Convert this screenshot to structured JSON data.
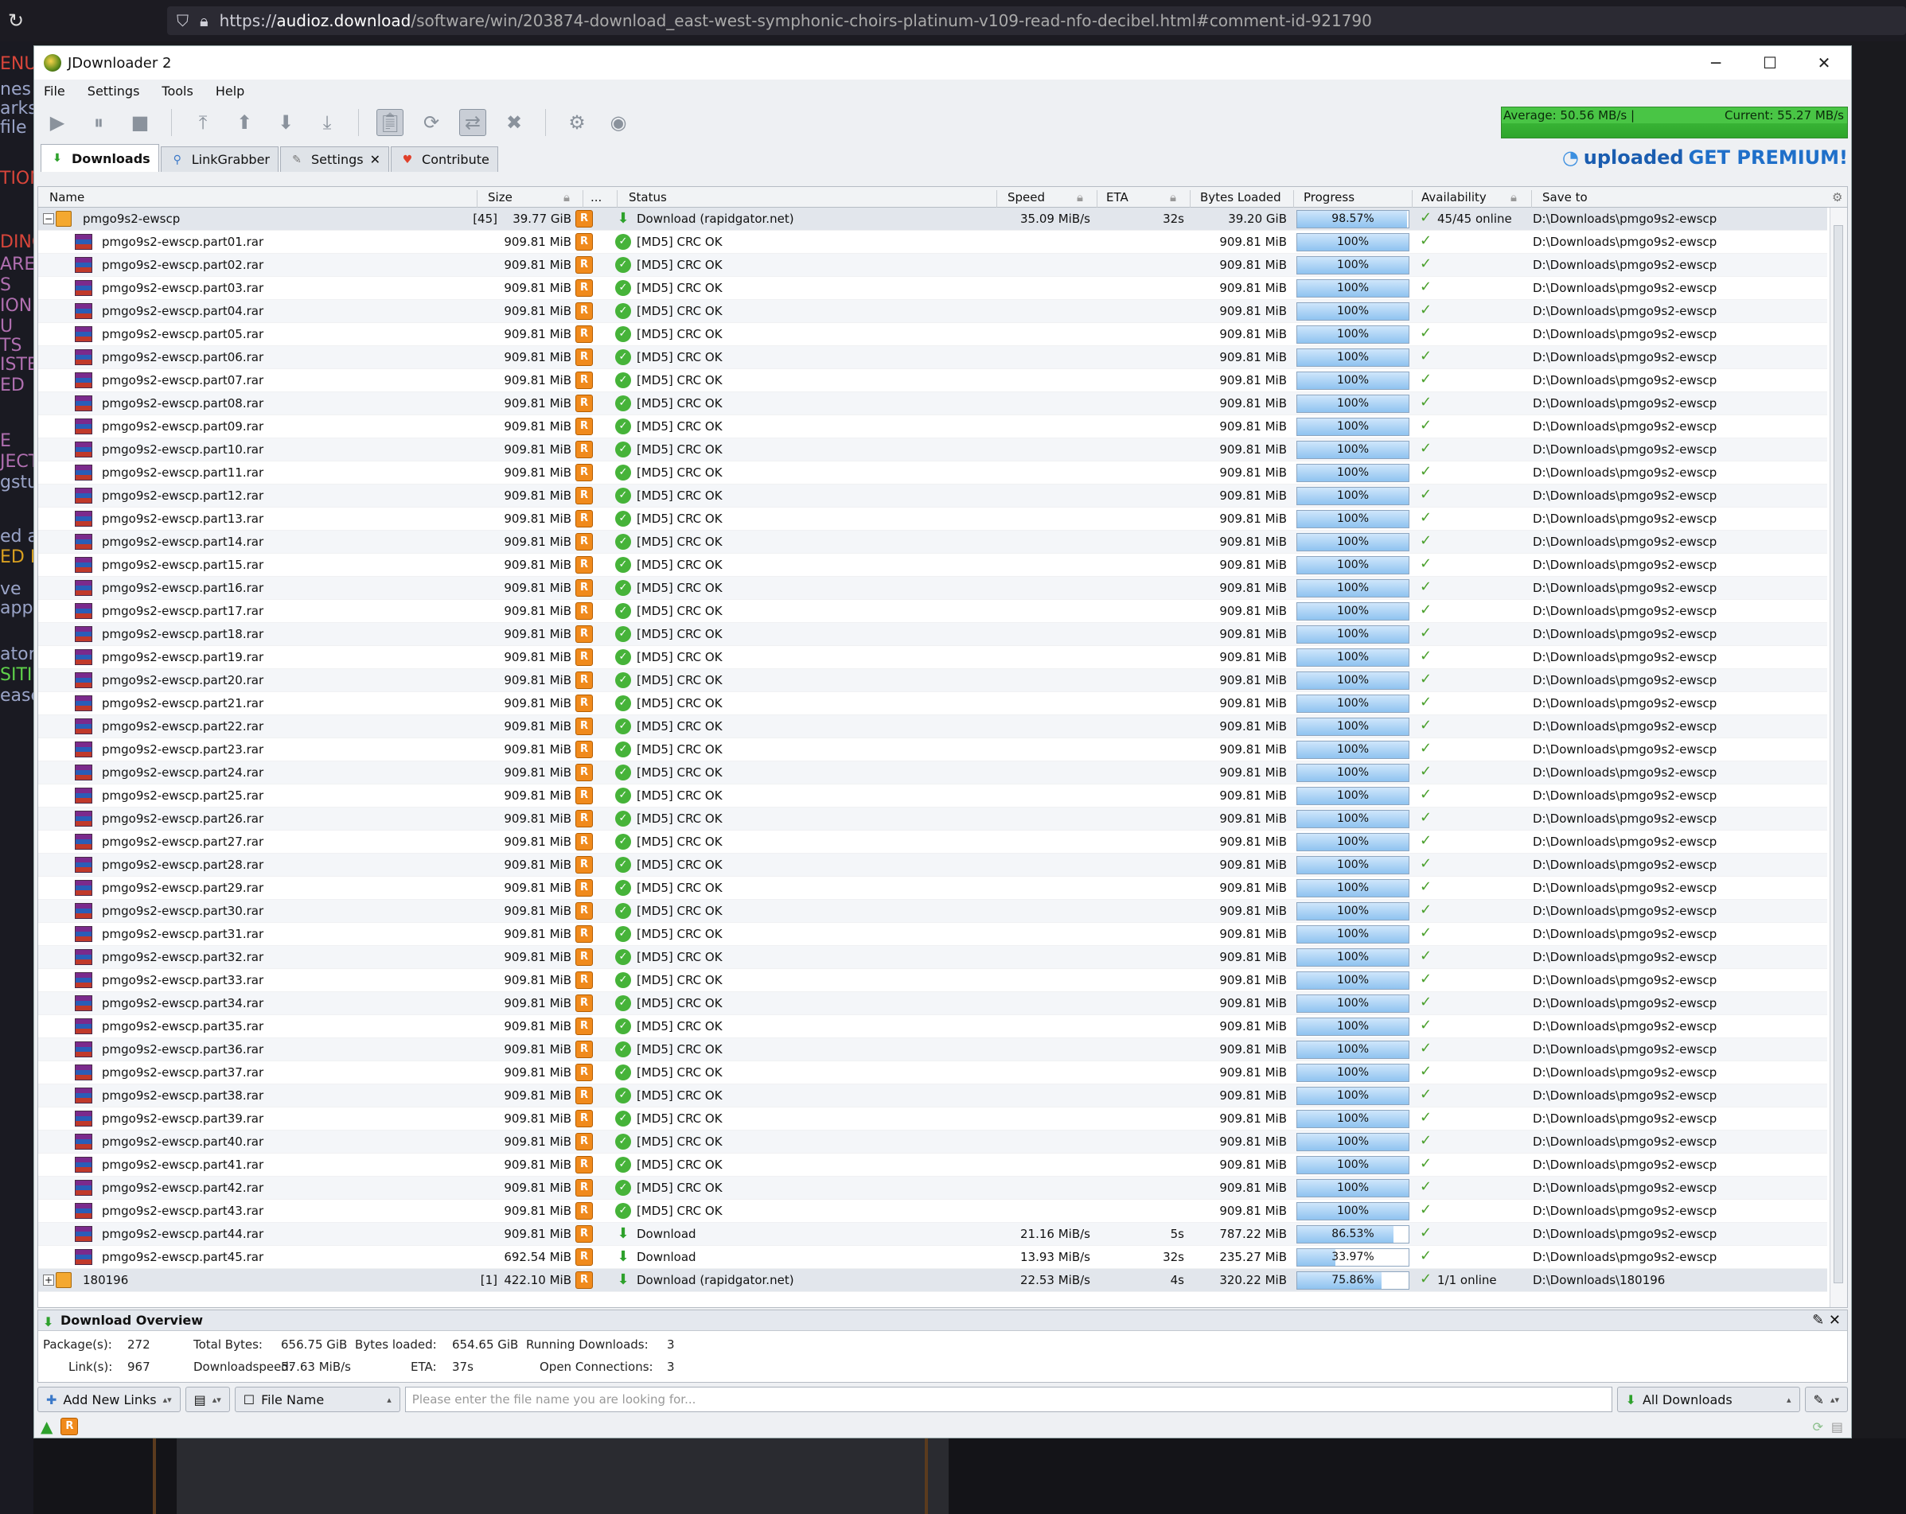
{
  "browser": {
    "url_domain": "audioz.download",
    "url_prefix": "https://",
    "url_rest": "/software/win/203874-download_east-west-symphonic-choirs-platinum-v109-read-nfo-decibel.html#comment-id-921790"
  },
  "background": {
    "left_snippets": [
      {
        "text": "ENU",
        "color": "#d8453a"
      },
      {
        "text": "nes (",
        "color": "#9aa4c8"
      },
      {
        "text": "arks",
        "color": "#9aa4c8"
      },
      {
        "text": "file",
        "color": "#9aa4c8"
      },
      {
        "text": "TION",
        "color": "#d8453a"
      },
      {
        "text": "DING",
        "color": "#d8453a"
      },
      {
        "text": "ARE",
        "color": "#b06fb0"
      },
      {
        "text": "S",
        "color": "#b06fb0"
      },
      {
        "text": "ION",
        "color": "#b06fb0"
      },
      {
        "text": "U",
        "color": "#b06fb0"
      },
      {
        "text": "TS",
        "color": "#b06fb0"
      },
      {
        "text": "ISTE",
        "color": "#b06fb0"
      },
      {
        "text": "ED",
        "color": "#b06fb0"
      },
      {
        "text": "E",
        "color": "#b06fb0"
      },
      {
        "text": "JECT",
        "color": "#b06fb0"
      },
      {
        "text": "gstu",
        "color": "#9aa4c8"
      },
      {
        "text": "ed a",
        "color": "#9aa4c8"
      },
      {
        "text": "ED F",
        "color": "#d9a020"
      },
      {
        "text": "appy",
        "color": "#9aa4c8"
      },
      {
        "text": "ator",
        "color": "#9aa4c8"
      },
      {
        "text": "SITI",
        "color": "#5fd14a"
      },
      {
        "text": "ease",
        "color": "#9aa4c8"
      },
      {
        "text": "ve",
        "color": "#9aa4c8"
      }
    ]
  },
  "window": {
    "title": "JDownloader 2",
    "controls": [
      "─",
      "☐",
      "✕"
    ]
  },
  "menu": [
    "File",
    "Settings",
    "Tools",
    "Help"
  ],
  "speedmeter": {
    "average": "Average: 50.56 MB/s |",
    "current": "Current: 55.27 MB/s"
  },
  "tabs": [
    {
      "label": "Downloads",
      "icon": "download-arrow-icon",
      "active": true
    },
    {
      "label": "LinkGrabber",
      "icon": "linkgrabber-icon",
      "active": false
    },
    {
      "label": "Settings",
      "icon": "wrench-icon",
      "active": false,
      "closable": true
    },
    {
      "label": "Contribute",
      "icon": "heart-icon",
      "active": false
    }
  ],
  "premium": {
    "brand": "uploaded",
    "cta": "GET PREMIUM!"
  },
  "columns": [
    "Name",
    "Size",
    "...",
    "Status",
    "Speed",
    "ETA",
    "Bytes Loaded",
    "Progress",
    "Availability",
    "Save to"
  ],
  "package1": {
    "expander": "−",
    "name": "pmgo9s2-ewscp",
    "count": "[45]",
    "size": "39.77 GiB",
    "status": "Download (rapidgator.net)",
    "speed": "35.09 MiB/s",
    "eta": "32s",
    "loaded": "39.20 GiB",
    "progress": "98.57%",
    "progress_value": 0.9857,
    "availability": "45/45 online",
    "saveto": "D:\\Downloads\\pmgo9s2-ewscp"
  },
  "files": [
    {
      "name": "pmgo9s2-ewscp.part01.rar",
      "size": "909.81 MiB",
      "status": "[MD5] CRC OK",
      "speed": "",
      "eta": "",
      "loaded": "909.81 MiB",
      "progress": "100%",
      "pv": 1,
      "ok": true
    },
    {
      "name": "pmgo9s2-ewscp.part02.rar",
      "size": "909.81 MiB",
      "status": "[MD5] CRC OK",
      "speed": "",
      "eta": "",
      "loaded": "909.81 MiB",
      "progress": "100%",
      "pv": 1,
      "ok": true
    },
    {
      "name": "pmgo9s2-ewscp.part03.rar",
      "size": "909.81 MiB",
      "status": "[MD5] CRC OK",
      "speed": "",
      "eta": "",
      "loaded": "909.81 MiB",
      "progress": "100%",
      "pv": 1,
      "ok": true
    },
    {
      "name": "pmgo9s2-ewscp.part04.rar",
      "size": "909.81 MiB",
      "status": "[MD5] CRC OK",
      "speed": "",
      "eta": "",
      "loaded": "909.81 MiB",
      "progress": "100%",
      "pv": 1,
      "ok": true
    },
    {
      "name": "pmgo9s2-ewscp.part05.rar",
      "size": "909.81 MiB",
      "status": "[MD5] CRC OK",
      "speed": "",
      "eta": "",
      "loaded": "909.81 MiB",
      "progress": "100%",
      "pv": 1,
      "ok": true
    },
    {
      "name": "pmgo9s2-ewscp.part06.rar",
      "size": "909.81 MiB",
      "status": "[MD5] CRC OK",
      "speed": "",
      "eta": "",
      "loaded": "909.81 MiB",
      "progress": "100%",
      "pv": 1,
      "ok": true
    },
    {
      "name": "pmgo9s2-ewscp.part07.rar",
      "size": "909.81 MiB",
      "status": "[MD5] CRC OK",
      "speed": "",
      "eta": "",
      "loaded": "909.81 MiB",
      "progress": "100%",
      "pv": 1,
      "ok": true
    },
    {
      "name": "pmgo9s2-ewscp.part08.rar",
      "size": "909.81 MiB",
      "status": "[MD5] CRC OK",
      "speed": "",
      "eta": "",
      "loaded": "909.81 MiB",
      "progress": "100%",
      "pv": 1,
      "ok": true
    },
    {
      "name": "pmgo9s2-ewscp.part09.rar",
      "size": "909.81 MiB",
      "status": "[MD5] CRC OK",
      "speed": "",
      "eta": "",
      "loaded": "909.81 MiB",
      "progress": "100%",
      "pv": 1,
      "ok": true
    },
    {
      "name": "pmgo9s2-ewscp.part10.rar",
      "size": "909.81 MiB",
      "status": "[MD5] CRC OK",
      "speed": "",
      "eta": "",
      "loaded": "909.81 MiB",
      "progress": "100%",
      "pv": 1,
      "ok": true
    },
    {
      "name": "pmgo9s2-ewscp.part11.rar",
      "size": "909.81 MiB",
      "status": "[MD5] CRC OK",
      "speed": "",
      "eta": "",
      "loaded": "909.81 MiB",
      "progress": "100%",
      "pv": 1,
      "ok": true
    },
    {
      "name": "pmgo9s2-ewscp.part12.rar",
      "size": "909.81 MiB",
      "status": "[MD5] CRC OK",
      "speed": "",
      "eta": "",
      "loaded": "909.81 MiB",
      "progress": "100%",
      "pv": 1,
      "ok": true
    },
    {
      "name": "pmgo9s2-ewscp.part13.rar",
      "size": "909.81 MiB",
      "status": "[MD5] CRC OK",
      "speed": "",
      "eta": "",
      "loaded": "909.81 MiB",
      "progress": "100%",
      "pv": 1,
      "ok": true
    },
    {
      "name": "pmgo9s2-ewscp.part14.rar",
      "size": "909.81 MiB",
      "status": "[MD5] CRC OK",
      "speed": "",
      "eta": "",
      "loaded": "909.81 MiB",
      "progress": "100%",
      "pv": 1,
      "ok": true
    },
    {
      "name": "pmgo9s2-ewscp.part15.rar",
      "size": "909.81 MiB",
      "status": "[MD5] CRC OK",
      "speed": "",
      "eta": "",
      "loaded": "909.81 MiB",
      "progress": "100%",
      "pv": 1,
      "ok": true
    },
    {
      "name": "pmgo9s2-ewscp.part16.rar",
      "size": "909.81 MiB",
      "status": "[MD5] CRC OK",
      "speed": "",
      "eta": "",
      "loaded": "909.81 MiB",
      "progress": "100%",
      "pv": 1,
      "ok": true
    },
    {
      "name": "pmgo9s2-ewscp.part17.rar",
      "size": "909.81 MiB",
      "status": "[MD5] CRC OK",
      "speed": "",
      "eta": "",
      "loaded": "909.81 MiB",
      "progress": "100%",
      "pv": 1,
      "ok": true
    },
    {
      "name": "pmgo9s2-ewscp.part18.rar",
      "size": "909.81 MiB",
      "status": "[MD5] CRC OK",
      "speed": "",
      "eta": "",
      "loaded": "909.81 MiB",
      "progress": "100%",
      "pv": 1,
      "ok": true
    },
    {
      "name": "pmgo9s2-ewscp.part19.rar",
      "size": "909.81 MiB",
      "status": "[MD5] CRC OK",
      "speed": "",
      "eta": "",
      "loaded": "909.81 MiB",
      "progress": "100%",
      "pv": 1,
      "ok": true
    },
    {
      "name": "pmgo9s2-ewscp.part20.rar",
      "size": "909.81 MiB",
      "status": "[MD5] CRC OK",
      "speed": "",
      "eta": "",
      "loaded": "909.81 MiB",
      "progress": "100%",
      "pv": 1,
      "ok": true
    },
    {
      "name": "pmgo9s2-ewscp.part21.rar",
      "size": "909.81 MiB",
      "status": "[MD5] CRC OK",
      "speed": "",
      "eta": "",
      "loaded": "909.81 MiB",
      "progress": "100%",
      "pv": 1,
      "ok": true
    },
    {
      "name": "pmgo9s2-ewscp.part22.rar",
      "size": "909.81 MiB",
      "status": "[MD5] CRC OK",
      "speed": "",
      "eta": "",
      "loaded": "909.81 MiB",
      "progress": "100%",
      "pv": 1,
      "ok": true
    },
    {
      "name": "pmgo9s2-ewscp.part23.rar",
      "size": "909.81 MiB",
      "status": "[MD5] CRC OK",
      "speed": "",
      "eta": "",
      "loaded": "909.81 MiB",
      "progress": "100%",
      "pv": 1,
      "ok": true
    },
    {
      "name": "pmgo9s2-ewscp.part24.rar",
      "size": "909.81 MiB",
      "status": "[MD5] CRC OK",
      "speed": "",
      "eta": "",
      "loaded": "909.81 MiB",
      "progress": "100%",
      "pv": 1,
      "ok": true
    },
    {
      "name": "pmgo9s2-ewscp.part25.rar",
      "size": "909.81 MiB",
      "status": "[MD5] CRC OK",
      "speed": "",
      "eta": "",
      "loaded": "909.81 MiB",
      "progress": "100%",
      "pv": 1,
      "ok": true
    },
    {
      "name": "pmgo9s2-ewscp.part26.rar",
      "size": "909.81 MiB",
      "status": "[MD5] CRC OK",
      "speed": "",
      "eta": "",
      "loaded": "909.81 MiB",
      "progress": "100%",
      "pv": 1,
      "ok": true
    },
    {
      "name": "pmgo9s2-ewscp.part27.rar",
      "size": "909.81 MiB",
      "status": "[MD5] CRC OK",
      "speed": "",
      "eta": "",
      "loaded": "909.81 MiB",
      "progress": "100%",
      "pv": 1,
      "ok": true
    },
    {
      "name": "pmgo9s2-ewscp.part28.rar",
      "size": "909.81 MiB",
      "status": "[MD5] CRC OK",
      "speed": "",
      "eta": "",
      "loaded": "909.81 MiB",
      "progress": "100%",
      "pv": 1,
      "ok": true
    },
    {
      "name": "pmgo9s2-ewscp.part29.rar",
      "size": "909.81 MiB",
      "status": "[MD5] CRC OK",
      "speed": "",
      "eta": "",
      "loaded": "909.81 MiB",
      "progress": "100%",
      "pv": 1,
      "ok": true
    },
    {
      "name": "pmgo9s2-ewscp.part30.rar",
      "size": "909.81 MiB",
      "status": "[MD5] CRC OK",
      "speed": "",
      "eta": "",
      "loaded": "909.81 MiB",
      "progress": "100%",
      "pv": 1,
      "ok": true
    },
    {
      "name": "pmgo9s2-ewscp.part31.rar",
      "size": "909.81 MiB",
      "status": "[MD5] CRC OK",
      "speed": "",
      "eta": "",
      "loaded": "909.81 MiB",
      "progress": "100%",
      "pv": 1,
      "ok": true
    },
    {
      "name": "pmgo9s2-ewscp.part32.rar",
      "size": "909.81 MiB",
      "status": "[MD5] CRC OK",
      "speed": "",
      "eta": "",
      "loaded": "909.81 MiB",
      "progress": "100%",
      "pv": 1,
      "ok": true
    },
    {
      "name": "pmgo9s2-ewscp.part33.rar",
      "size": "909.81 MiB",
      "status": "[MD5] CRC OK",
      "speed": "",
      "eta": "",
      "loaded": "909.81 MiB",
      "progress": "100%",
      "pv": 1,
      "ok": true
    },
    {
      "name": "pmgo9s2-ewscp.part34.rar",
      "size": "909.81 MiB",
      "status": "[MD5] CRC OK",
      "speed": "",
      "eta": "",
      "loaded": "909.81 MiB",
      "progress": "100%",
      "pv": 1,
      "ok": true
    },
    {
      "name": "pmgo9s2-ewscp.part35.rar",
      "size": "909.81 MiB",
      "status": "[MD5] CRC OK",
      "speed": "",
      "eta": "",
      "loaded": "909.81 MiB",
      "progress": "100%",
      "pv": 1,
      "ok": true
    },
    {
      "name": "pmgo9s2-ewscp.part36.rar",
      "size": "909.81 MiB",
      "status": "[MD5] CRC OK",
      "speed": "",
      "eta": "",
      "loaded": "909.81 MiB",
      "progress": "100%",
      "pv": 1,
      "ok": true
    },
    {
      "name": "pmgo9s2-ewscp.part37.rar",
      "size": "909.81 MiB",
      "status": "[MD5] CRC OK",
      "speed": "",
      "eta": "",
      "loaded": "909.81 MiB",
      "progress": "100%",
      "pv": 1,
      "ok": true
    },
    {
      "name": "pmgo9s2-ewscp.part38.rar",
      "size": "909.81 MiB",
      "status": "[MD5] CRC OK",
      "speed": "",
      "eta": "",
      "loaded": "909.81 MiB",
      "progress": "100%",
      "pv": 1,
      "ok": true
    },
    {
      "name": "pmgo9s2-ewscp.part39.rar",
      "size": "909.81 MiB",
      "status": "[MD5] CRC OK",
      "speed": "",
      "eta": "",
      "loaded": "909.81 MiB",
      "progress": "100%",
      "pv": 1,
      "ok": true
    },
    {
      "name": "pmgo9s2-ewscp.part40.rar",
      "size": "909.81 MiB",
      "status": "[MD5] CRC OK",
      "speed": "",
      "eta": "",
      "loaded": "909.81 MiB",
      "progress": "100%",
      "pv": 1,
      "ok": true
    },
    {
      "name": "pmgo9s2-ewscp.part41.rar",
      "size": "909.81 MiB",
      "status": "[MD5] CRC OK",
      "speed": "",
      "eta": "",
      "loaded": "909.81 MiB",
      "progress": "100%",
      "pv": 1,
      "ok": true
    },
    {
      "name": "pmgo9s2-ewscp.part42.rar",
      "size": "909.81 MiB",
      "status": "[MD5] CRC OK",
      "speed": "",
      "eta": "",
      "loaded": "909.81 MiB",
      "progress": "100%",
      "pv": 1,
      "ok": true
    },
    {
      "name": "pmgo9s2-ewscp.part43.rar",
      "size": "909.81 MiB",
      "status": "[MD5] CRC OK",
      "speed": "",
      "eta": "",
      "loaded": "909.81 MiB",
      "progress": "100%",
      "pv": 1,
      "ok": true
    },
    {
      "name": "pmgo9s2-ewscp.part44.rar",
      "size": "909.81 MiB",
      "status": "Download",
      "speed": "21.16 MiB/s",
      "eta": "5s",
      "loaded": "787.22 MiB",
      "progress": "86.53%",
      "pv": 0.8653,
      "ok": false
    },
    {
      "name": "pmgo9s2-ewscp.part45.rar",
      "size": "692.54 MiB",
      "status": "Download",
      "speed": "13.93 MiB/s",
      "eta": "32s",
      "loaded": "235.27 MiB",
      "progress": "33.97%",
      "pv": 0.3397,
      "ok": false
    }
  ],
  "file_saveto": "D:\\Downloads\\pmgo9s2-ewscp",
  "package2": {
    "expander": "+",
    "name": "180196",
    "count": "[1]",
    "size": "422.10 MiB",
    "status": "Download (rapidgator.net)",
    "speed": "22.53 MiB/s",
    "eta": "4s",
    "loaded": "320.22 MiB",
    "progress": "75.86%",
    "progress_value": 0.7586,
    "availability": "1/1 online",
    "saveto": "D:\\Downloads\\180196"
  },
  "overview": {
    "title": "Download Overview",
    "packages_label": "Package(s):",
    "packages": "272",
    "total_label": "Total Bytes:",
    "total": "656.75 GiB",
    "loaded_label": "Bytes loaded:",
    "loaded": "654.65 GiB",
    "running_label": "Running Downloads:",
    "running": "3",
    "links_label": "Link(s):",
    "links": "967",
    "speed_label": "Downloadspeed:",
    "speed": "57.63 MiB/s",
    "eta_label": "ETA:",
    "eta": "37s",
    "conn_label": "Open Connections:",
    "conn": "3"
  },
  "bottom": {
    "add_links": "Add New Links",
    "filter_field": "File Name",
    "search_placeholder": "Please enter the file name you are looking for...",
    "view_select": "All Downloads"
  }
}
